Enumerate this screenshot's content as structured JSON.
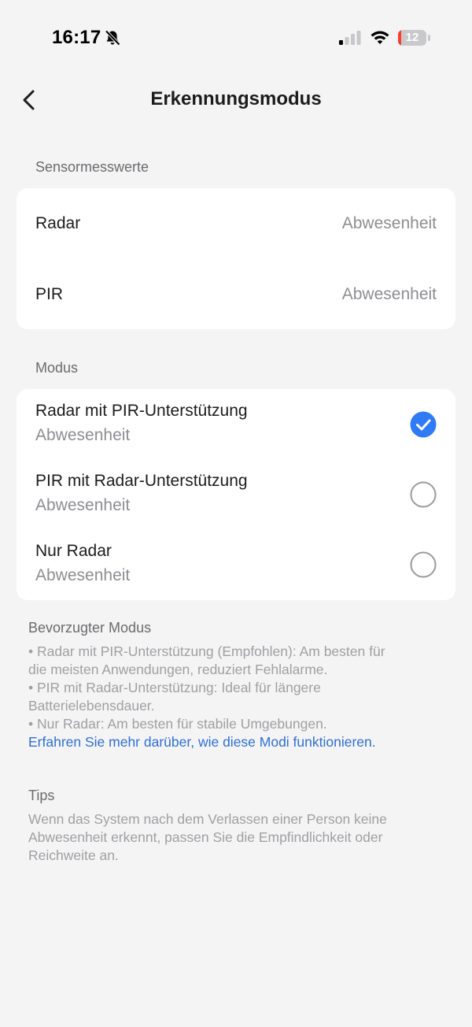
{
  "status_bar": {
    "time": "16:17",
    "battery_percent": "12",
    "battery_level": 0.12,
    "icons": [
      "bell-slash-icon",
      "cellular-signal-icon",
      "wifi-icon",
      "battery-icon"
    ]
  },
  "nav": {
    "back_icon": "chevron-left-icon",
    "title": "Erkennungsmodus"
  },
  "sensor_readings": {
    "section_label": "Sensormesswerte",
    "items": [
      {
        "label": "Radar",
        "value": "Abwesenheit"
      },
      {
        "label": "PIR",
        "value": "Abwesenheit"
      }
    ]
  },
  "mode": {
    "section_label": "Modus",
    "items": [
      {
        "title": "Radar mit PIR-Unterstützung",
        "status": "Abwesenheit",
        "selected": true
      },
      {
        "title": "PIR mit Radar-Unterstützung",
        "status": "Abwesenheit",
        "selected": false
      },
      {
        "title": "Nur Radar",
        "status": "Abwesenheit",
        "selected": false
      }
    ]
  },
  "preferred_mode": {
    "title": "Bevorzugter Modus",
    "lines": [
      "• Radar mit PIR-Unterstützung (Empfohlen): Am besten für",
      "die meisten Anwendungen, reduziert Fehlalarme.",
      "• PIR mit Radar-Unterstützung: Ideal für längere",
      "Batterielebensdauer.",
      "• Nur Radar: Am besten für stabile Umgebungen."
    ],
    "link": "Erfahren Sie mehr darüber, wie diese Modi funktionieren."
  },
  "tips": {
    "title": "Tips",
    "lines": [
      "Wenn das System nach dem Verlassen einer Person keine",
      "Abwesenheit erkennt, passen Sie die Empfindlichkeit oder",
      "Reichweite an."
    ]
  },
  "colors": {
    "background": "#f4f4f4",
    "card": "#ffffff",
    "accent": "#2f7bf5",
    "link": "#2f6fd8",
    "secondary_text": "#8e8e93",
    "battery_low": "#ff3b30"
  }
}
